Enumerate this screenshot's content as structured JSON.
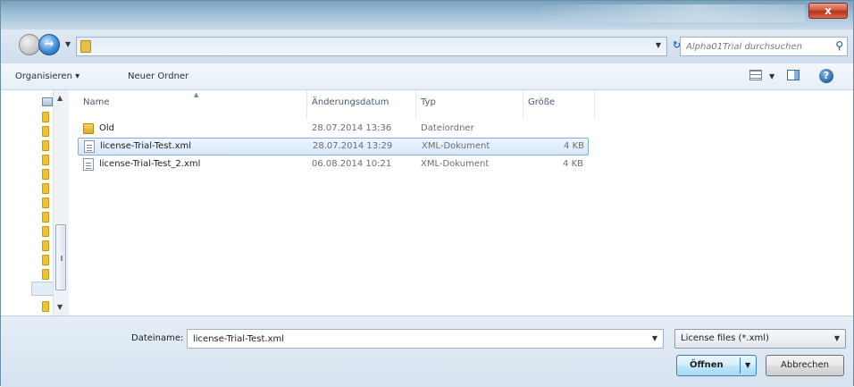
{
  "titlebar": {
    "close_label": "x"
  },
  "address": {
    "search_placeholder": "Alpha01Trial durchsuchen"
  },
  "toolbar": {
    "organize_label": "Organisieren ▾",
    "new_folder_label": "Neuer Ordner",
    "help_label": "?"
  },
  "columns": {
    "name": "Name",
    "date": "Änderungsdatum",
    "type": "Typ",
    "size": "Größe"
  },
  "files": [
    {
      "name": "Old",
      "date": "28.07.2014 13:36",
      "type": "Dateiordner",
      "size": "",
      "icon": "folder-icon"
    },
    {
      "name": "license-Trial-Test.xml",
      "date": "28.07.2014 13:29",
      "type": "XML-Dokument",
      "size": "4 KB",
      "icon": "xml-file-icon",
      "selected": true
    },
    {
      "name": "license-Trial-Test_2.xml",
      "date": "06.08.2014 10:21",
      "type": "XML-Dokument",
      "size": "4 KB",
      "icon": "xml-file-icon"
    }
  ],
  "bottom": {
    "filename_label": "Dateiname:",
    "filename_value": "license-Trial-Test.xml",
    "filter_value": "License files (*.xml)",
    "open_label": "Öffnen",
    "cancel_label": "Abbrechen"
  },
  "colors": {
    "selection_border": "#84acdd",
    "titlebar": "#9fbfd6",
    "close_button": "#c7472c"
  }
}
